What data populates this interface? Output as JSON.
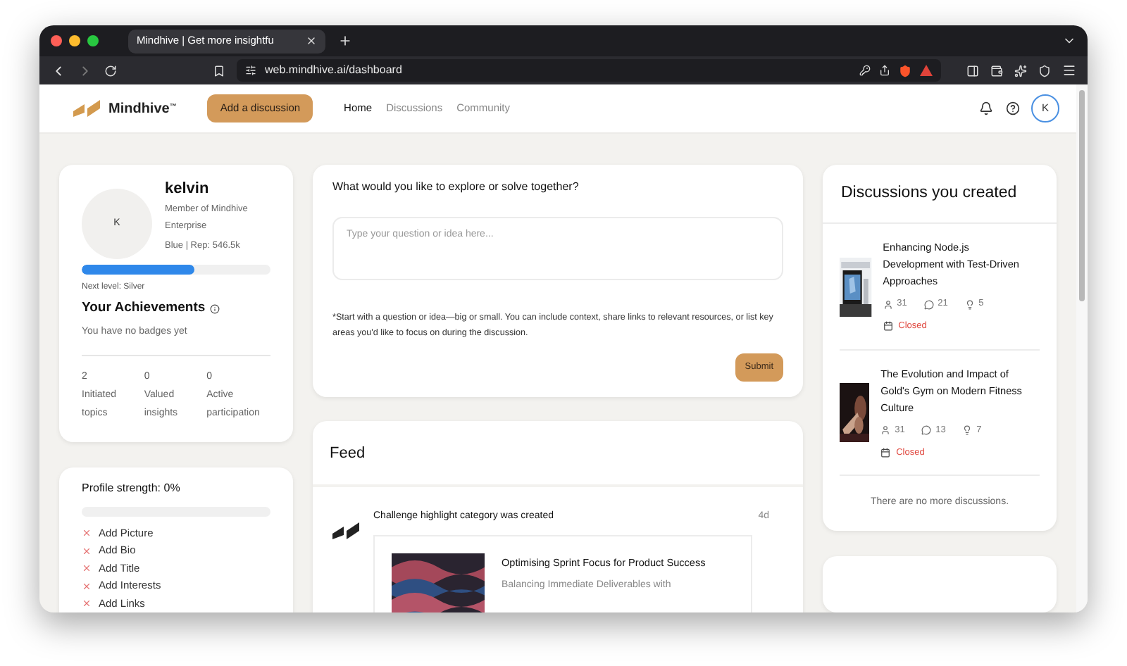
{
  "browser": {
    "tab_title": "Mindhive | Get more insightfu",
    "url": "web.mindhive.ai/dashboard"
  },
  "nav": {
    "logo": "Mindhive",
    "trademark": "™",
    "cta": "Add a discussion",
    "avatar": "K",
    "links": [
      {
        "label": "Home",
        "selected": true
      },
      {
        "label": "Discussions",
        "selected": false
      },
      {
        "label": "Community",
        "selected": false
      }
    ]
  },
  "profile": {
    "initial": "K",
    "name": "kelvin",
    "org": "Member of Mindhive Enterprise",
    "rank": "Blue | Rep: 546.5k",
    "level": 0.6,
    "next_level": "Next level: Silver",
    "achievements_title": "Your Achievements",
    "badges_note": "You have no badges yet",
    "stats": [
      {
        "value": "2",
        "label": "Initiated topics"
      },
      {
        "value": "0",
        "label": "Valued insights"
      },
      {
        "value": "0",
        "label": "Active participation"
      }
    ]
  },
  "profile_strength": {
    "title": "Profile strength: 0%",
    "level": 0,
    "tasks": [
      {
        "label": "Add Picture",
        "done": false
      },
      {
        "label": "Add Bio",
        "done": false
      },
      {
        "label": "Add Title",
        "done": false
      },
      {
        "label": "Add Interests",
        "done": false
      },
      {
        "label": "Add Links",
        "done": false
      }
    ]
  },
  "composer": {
    "question": "What would you like to explore or solve together?",
    "placeholder": "Type your question or idea here...",
    "note": "*Start with a question or idea—big or small. You can include context, share links to relevant resources, or list key areas you'd like to focus on during the discussion.",
    "submit": "Submit"
  },
  "feed": {
    "title": "Feed",
    "items": [
      {
        "headline": "Challenge highlight category was created",
        "time": "4d",
        "card_title": "Optimising Sprint Focus for Product Success",
        "card_subtitle": "Balancing Immediate Deliverables with"
      }
    ]
  },
  "discussions": {
    "title": "Discussions you created",
    "items": [
      {
        "title": "Enhancing Node.js Development with Test-Driven Approaches",
        "participants": "31",
        "comments": "21",
        "ideas": "5",
        "status": "Closed"
      },
      {
        "title": "The Evolution and Impact of Gold's Gym on Modern Fitness Culture",
        "participants": "31",
        "comments": "13",
        "ideas": "7",
        "status": "Closed"
      }
    ],
    "end_note": "There are no more discussions."
  }
}
